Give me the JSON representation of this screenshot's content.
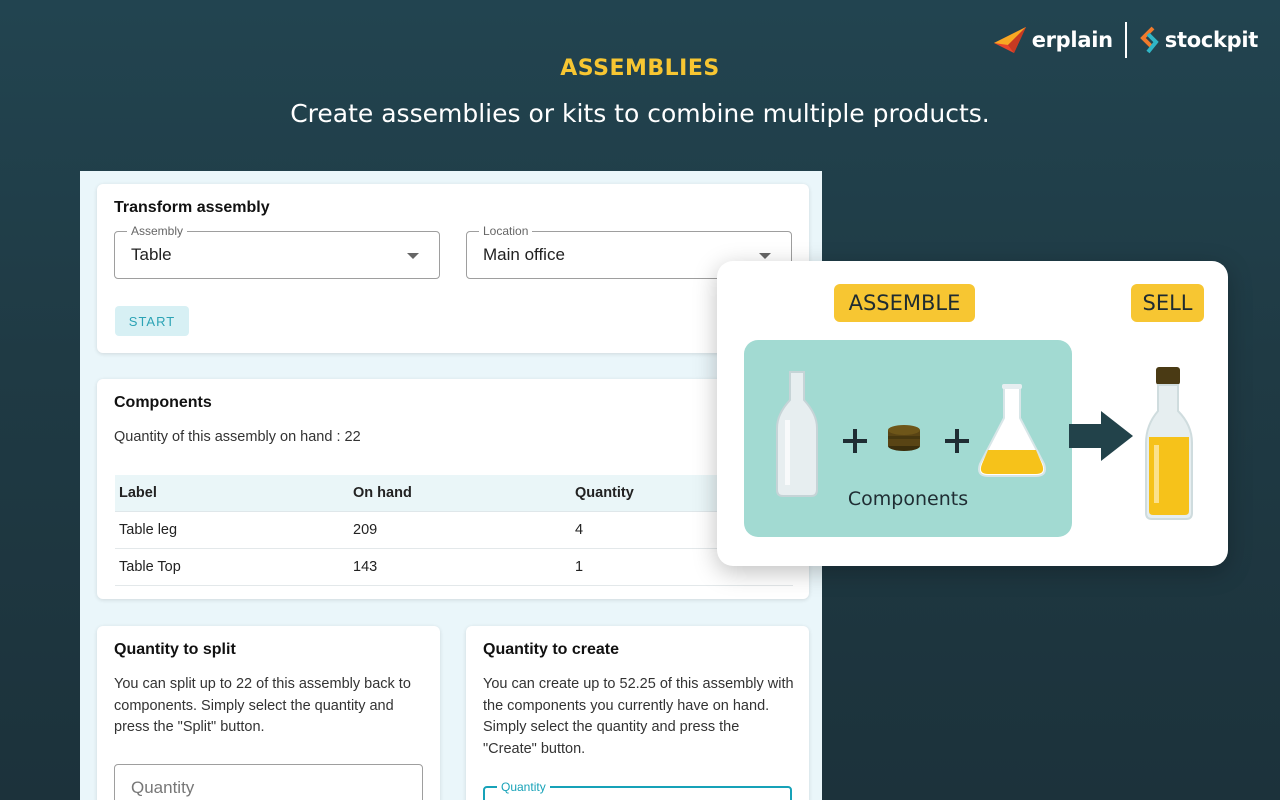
{
  "brand": {
    "logo1": "erplain",
    "logo2": "stockpit"
  },
  "header": {
    "title": "ASSEMBLIES",
    "subtitle": "Create assemblies or kits to combine multiple products."
  },
  "transform": {
    "title": "Transform assembly",
    "assembly_label": "Assembly",
    "assembly_value": "Table",
    "location_label": "Location",
    "location_value": "Main office",
    "start_label": "START"
  },
  "components": {
    "title": "Components",
    "on_hand_text": "Quantity of this assembly on hand : 22",
    "headers": [
      "Label",
      "On hand",
      "Quantity"
    ],
    "rows": [
      [
        "Table leg",
        "209",
        "4"
      ],
      [
        "Table Top",
        "143",
        "1"
      ]
    ]
  },
  "split": {
    "title": "Quantity to split",
    "description": "You can split up to 22 of this assembly back to components. Simply select the quantity and press the \"Split\" button.",
    "input_placeholder": "Quantity"
  },
  "create": {
    "title": "Quantity to create",
    "description": "You can create up to 52.25 of this assembly with the components you currently have on hand. Simply select the quantity and press the \"Create\" button.",
    "input_label": "Quantity"
  },
  "illustration": {
    "assemble_tag": "ASSEMBLE",
    "sell_tag": "SELL",
    "components_label": "Components",
    "icons": [
      "bottle-icon",
      "plus-icon",
      "cork-icon",
      "flask-oil-icon",
      "arrow-right-icon",
      "oil-bottle-icon"
    ]
  },
  "colors": {
    "accent_yellow": "#f7c632",
    "teal": "#17a2b8",
    "background": "#1f3a44",
    "components_box": "#a2dad2"
  }
}
